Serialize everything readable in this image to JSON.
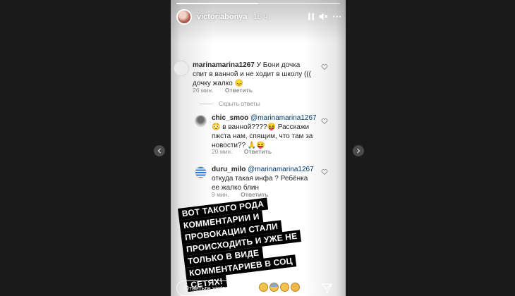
{
  "story": {
    "username": "victoriabonya",
    "time_ago": "16 ч.",
    "progress": 0.5,
    "more_label": "···"
  },
  "comments": [
    {
      "user": "marinamarina1267",
      "text": "У Бони дочка спит в ванной и не ходит в школу ((( дочку жалко",
      "emoji": "😞",
      "time": "26 мин.",
      "reply_label": "Ответить"
    }
  ],
  "hide_replies_label": "Скрыть ответы",
  "replies": [
    {
      "user": "chic_smoo",
      "mention": "@marinamarina1267",
      "text": "в ванной????",
      "text2": "Расскажи пжста нам, спящим, что там за новости??",
      "emoji1": "😳",
      "emoji2": "😝",
      "emoji3": "🙏😝",
      "time": "20 мин.",
      "reply_label": "Ответить"
    },
    {
      "user": "duru_milo",
      "mention": "@marinamarina1267",
      "text": "откуда такая инфа ? Ребёнка ее жалко блин",
      "time": "9 мин.",
      "reply_label": "Ответить"
    }
  ],
  "caption_lines": [
    "ВОТ ТАКОГО РОДА",
    "КОММЕНТАРИИ И",
    "ПРОВОКАЦИИ СТАЛИ",
    "ПРОИСХОДИТЬ И УЖЕ НЕ",
    "ТОЛЬКО В ВИДЕ",
    "КОММЕНТАРИЕВ В СОЦ",
    "СЕТЯХ!"
  ],
  "reply_bar": {
    "placeholder": "Ответьте victoriabonya..."
  },
  "icons": {
    "pause": "pause-icon",
    "mute": "mute-icon",
    "more": "more-icon",
    "heart": "heart-icon",
    "send": "send-icon",
    "nav_left": "chevron-left-icon",
    "nav_right": "chevron-right-icon"
  }
}
